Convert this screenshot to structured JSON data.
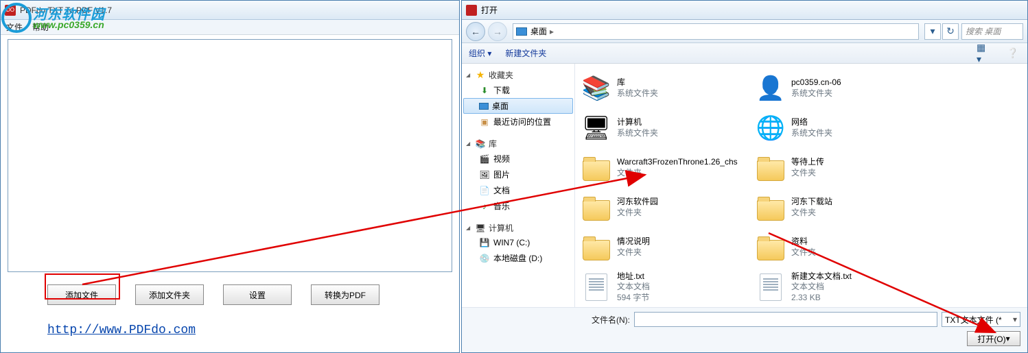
{
  "watermark": {
    "text1": "河东软件园",
    "text2": "www.pc0359.cn"
  },
  "app": {
    "title": "PDFdo TXT To PDF V1.7",
    "menu": {
      "file": "文件",
      "help": "帮助"
    },
    "buttons": {
      "add_file": "添加文件",
      "add_folder": "添加文件夹",
      "settings": "设置",
      "convert": "转换为PDF"
    },
    "link": "http://www.PDFdo.com"
  },
  "dialog": {
    "title": "打开",
    "breadcrumb": "桌面",
    "search_placeholder": "搜索 桌面",
    "toolbar": {
      "organize": "组织",
      "new_folder": "新建文件夹"
    },
    "nav": {
      "favorites": {
        "header": "收藏夹",
        "items": [
          "下载",
          "桌面",
          "最近访问的位置"
        ]
      },
      "libraries": {
        "header": "库",
        "items": [
          "视频",
          "图片",
          "文档",
          "音乐"
        ]
      },
      "computer": {
        "header": "计算机",
        "items": [
          "WIN7 (C:)",
          "本地磁盘 (D:)"
        ]
      }
    },
    "items": [
      {
        "name": "库",
        "sub": "系统文件夹",
        "type": "lib"
      },
      {
        "name": "pc0359.cn-06",
        "sub": "系统文件夹",
        "type": "user"
      },
      {
        "name": "计算机",
        "sub": "系统文件夹",
        "type": "pc"
      },
      {
        "name": "网络",
        "sub": "系统文件夹",
        "type": "net"
      },
      {
        "name": "Warcraft3FrozenThrone1.26_chs",
        "sub": "文件夹",
        "type": "folder"
      },
      {
        "name": "等待上传",
        "sub": "文件夹",
        "type": "folder"
      },
      {
        "name": "河东软件园",
        "sub": "文件夹",
        "type": "folder"
      },
      {
        "name": "河东下载站",
        "sub": "文件夹",
        "type": "folder"
      },
      {
        "name": "情况说明",
        "sub": "文件夹",
        "type": "folder"
      },
      {
        "name": "资料",
        "sub": "文件夹",
        "type": "folder"
      },
      {
        "name": "地址.txt",
        "sub": "文本文档",
        "sub2": "594 字节",
        "type": "txt"
      },
      {
        "name": "新建文本文档.txt",
        "sub": "文本文档",
        "sub2": "2.33 KB",
        "type": "txt"
      }
    ],
    "footer": {
      "filename_label": "文件名(N):",
      "filetype": "TXT文本文件 (*",
      "open": "打开(O)"
    }
  }
}
